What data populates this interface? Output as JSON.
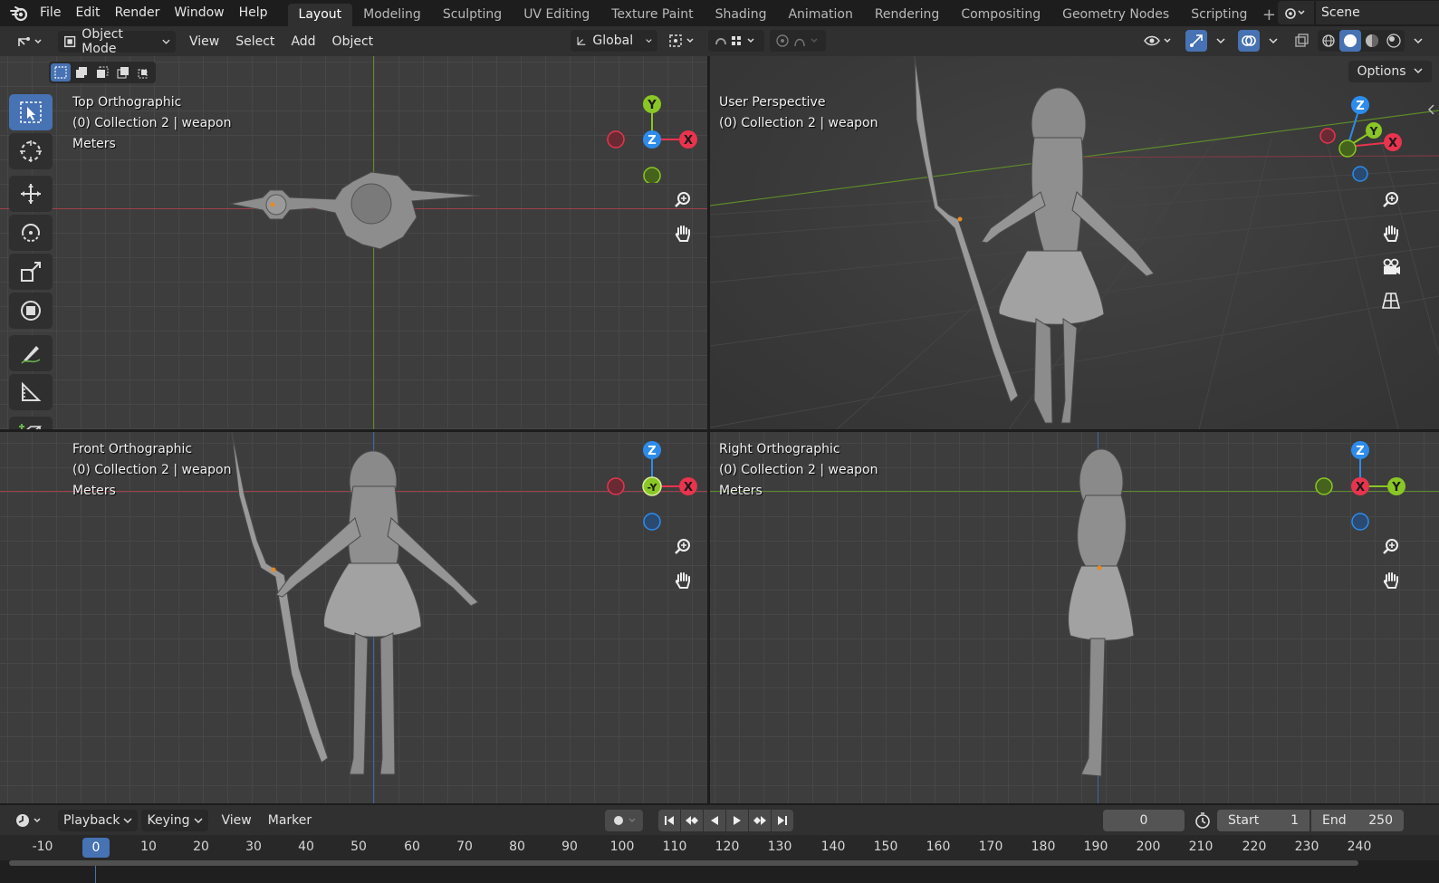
{
  "topbar": {
    "menus": [
      "File",
      "Edit",
      "Render",
      "Window",
      "Help"
    ],
    "workspaces": [
      "Layout",
      "Modeling",
      "Sculpting",
      "UV Editing",
      "Texture Paint",
      "Shading",
      "Animation",
      "Rendering",
      "Compositing",
      "Geometry Nodes",
      "Scripting"
    ],
    "active_workspace": "Layout",
    "scene_name": "Scene"
  },
  "view_header": {
    "mode": "Object Mode",
    "menus": [
      "View",
      "Select",
      "Add",
      "Object"
    ],
    "transform_orientation": "Global",
    "options_label": "Options"
  },
  "viewports": {
    "top": {
      "view_name": "Top Orthographic",
      "collection": "(0) Collection 2 | weapon",
      "units": "Meters",
      "gizmo": [
        "Y",
        "Z",
        "X"
      ]
    },
    "persp": {
      "view_name": "User Perspective",
      "collection": "(0) Collection 2 | weapon",
      "gizmo": [
        "Z",
        "Y",
        "X"
      ]
    },
    "front": {
      "view_name": "Front Orthographic",
      "collection": "(0) Collection 2 | weapon",
      "units": "Meters",
      "gizmo": [
        "Z",
        "-Y",
        "X"
      ]
    },
    "right": {
      "view_name": "Right Orthographic",
      "collection": "(0) Collection 2 | weapon",
      "units": "Meters",
      "gizmo": [
        "Z",
        "X",
        "Y"
      ]
    }
  },
  "timeline": {
    "menus": [
      "Playback",
      "Keying",
      "View",
      "Marker"
    ],
    "current_frame": "0",
    "start_label": "Start",
    "start_value": "1",
    "end_label": "End",
    "end_value": "250",
    "ruler": [
      "-10",
      "0",
      "10",
      "20",
      "30",
      "40",
      "50",
      "60",
      "70",
      "80",
      "90",
      "100",
      "110",
      "120",
      "130",
      "140",
      "150",
      "160",
      "170",
      "180",
      "190",
      "200",
      "210",
      "220",
      "230",
      "240"
    ]
  },
  "colors": {
    "accent": "#4772b3",
    "axis_x": "#e8344e",
    "axis_y": "#8ac625",
    "axis_z": "#2d8ceb",
    "viewport_bg": "#3d3d3d"
  }
}
